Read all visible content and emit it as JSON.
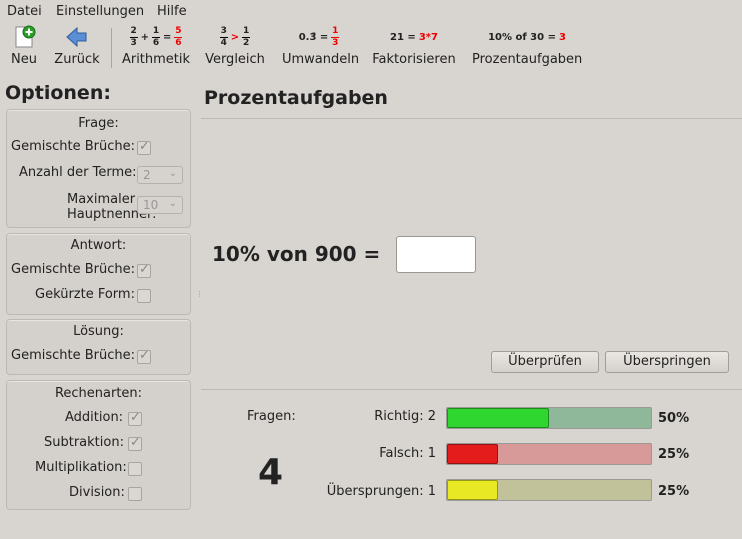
{
  "menu": {
    "file": "Datei",
    "settings": "Einstellungen",
    "help": "Hilfe"
  },
  "toolbar": {
    "new": "Neu",
    "back": "Zurück",
    "arithmetic": "Arithmetik",
    "compare": "Vergleich",
    "convert": "Umwandeln",
    "factorize": "Faktorisieren",
    "percentage": "Prozentaufgaben",
    "icon_factor_left": "21 =",
    "icon_factor_right": "3*7",
    "icon_percent_left": "10% of 30 =",
    "icon_percent_right": "3",
    "icon_convert_left": "0.3̄ =",
    "icon_arith_a_num": "2",
    "icon_arith_a_den": "3",
    "icon_arith_b_num": "1",
    "icon_arith_b_den": "6",
    "icon_arith_r_num": "5",
    "icon_arith_r_den": "6",
    "icon_cmp_a_num": "3",
    "icon_cmp_a_den": "4",
    "icon_cmp_b_num": "1",
    "icon_cmp_b_den": "2",
    "icon_conv_num": "1",
    "icon_conv_den": "3",
    "icon_plus": "+",
    "icon_eq": "=",
    "icon_gt": ">"
  },
  "sidebar": {
    "title": "Optionen:",
    "question": {
      "title": "Frage:",
      "mixed_fractions": "Gemischte Brüche:",
      "mixed_checked": true,
      "term_count_label": "Anzahl der Terme:",
      "term_count_value": "2",
      "max_denominator_label_1": "Maximaler",
      "max_denominator_label_2": "Hauptnenner:",
      "max_denominator_value": "10"
    },
    "answer": {
      "title": "Antwort:",
      "mixed_fractions": "Gemischte Brüche:",
      "mixed_checked": true,
      "reduced_form": "Gekürzte Form:",
      "reduced_checked": false
    },
    "solution": {
      "title": "Lösung:",
      "mixed_fractions": "Gemischte Brüche:",
      "mixed_checked": true
    },
    "operations": {
      "title": "Rechenarten:",
      "addition": "Addition:",
      "addition_checked": true,
      "subtraction": "Subtraktion:",
      "subtraction_checked": true,
      "multiplication": "Multiplikation:",
      "multiplication_checked": false,
      "division": "Division:",
      "division_checked": false
    }
  },
  "main": {
    "title": "Prozentaufgaben",
    "question": "10% von 900 =",
    "answer_value": "",
    "check_button": "Überprüfen",
    "skip_button": "Überspringen"
  },
  "stats": {
    "questions_label": "Fragen:",
    "questions_count": "4",
    "correct_label": "Richtig: 2",
    "correct_pct": "50%",
    "correct_fraction": 0.5,
    "wrong_label": "Falsch: 1",
    "wrong_pct": "25%",
    "wrong_fraction": 0.25,
    "skipped_label": "Übersprungen: 1",
    "skipped_pct": "25%",
    "skipped_fraction": 0.25,
    "colors": {
      "correct": "#2fd62f",
      "wrong": "#e51c1c",
      "skipped": "#e8e824"
    }
  }
}
